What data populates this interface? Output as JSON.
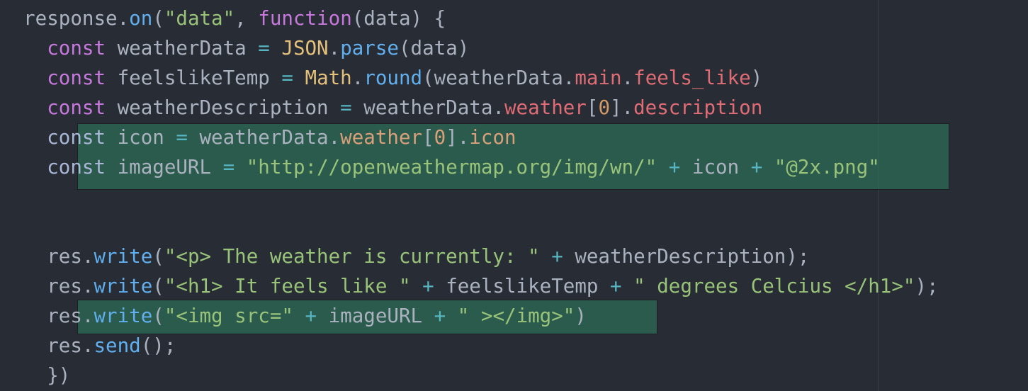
{
  "editor": {
    "lines": [
      {
        "indent": "  ",
        "tokens": [
          {
            "t": "response",
            "c": "id"
          },
          {
            "t": ".",
            "c": "id"
          },
          {
            "t": "on",
            "c": "f"
          },
          {
            "t": "(",
            "c": "id"
          },
          {
            "t": "\"data\"",
            "c": "s"
          },
          {
            "t": ", ",
            "c": "id"
          },
          {
            "t": "function",
            "c": "k"
          },
          {
            "t": "(data) {",
            "c": "id"
          }
        ]
      },
      {
        "indent": "    ",
        "tokens": [
          {
            "t": "const",
            "c": "k"
          },
          {
            "t": " weatherData ",
            "c": "id"
          },
          {
            "t": "=",
            "c": "o"
          },
          {
            "t": " ",
            "c": "id"
          },
          {
            "t": "JSON",
            "c": "c"
          },
          {
            "t": ".",
            "c": "id"
          },
          {
            "t": "parse",
            "c": "f"
          },
          {
            "t": "(data)",
            "c": "id"
          }
        ]
      },
      {
        "indent": "    ",
        "tokens": [
          {
            "t": "const",
            "c": "k"
          },
          {
            "t": " feelslikeTemp ",
            "c": "id"
          },
          {
            "t": "=",
            "c": "o"
          },
          {
            "t": " ",
            "c": "id"
          },
          {
            "t": "Math",
            "c": "c"
          },
          {
            "t": ".",
            "c": "id"
          },
          {
            "t": "round",
            "c": "f"
          },
          {
            "t": "(weatherData.",
            "c": "id"
          },
          {
            "t": "main",
            "c": "p"
          },
          {
            "t": ".",
            "c": "id"
          },
          {
            "t": "feels_like",
            "c": "p"
          },
          {
            "t": ")",
            "c": "id"
          }
        ]
      },
      {
        "indent": "    ",
        "tokens": [
          {
            "t": "const",
            "c": "k"
          },
          {
            "t": " weatherDescription ",
            "c": "id"
          },
          {
            "t": "=",
            "c": "o"
          },
          {
            "t": " weatherData.",
            "c": "id"
          },
          {
            "t": "weather",
            "c": "p"
          },
          {
            "t": "[",
            "c": "id"
          },
          {
            "t": "0",
            "c": "n"
          },
          {
            "t": "].",
            "c": "id"
          },
          {
            "t": "description",
            "c": "p"
          }
        ]
      },
      {
        "indent": "    ",
        "selected": true,
        "tokens": [
          {
            "t": "const",
            "c": "k"
          },
          {
            "t": " icon ",
            "c": "id"
          },
          {
            "t": "=",
            "c": "o"
          },
          {
            "t": " weatherData.",
            "c": "id"
          },
          {
            "t": "weather",
            "c": "p"
          },
          {
            "t": "[",
            "c": "id"
          },
          {
            "t": "0",
            "c": "n"
          },
          {
            "t": "].",
            "c": "id"
          },
          {
            "t": "icon",
            "c": "p"
          }
        ]
      },
      {
        "indent": "    ",
        "selected": true,
        "tokens": [
          {
            "t": "const",
            "c": "k"
          },
          {
            "t": " imageURL ",
            "c": "id"
          },
          {
            "t": "=",
            "c": "o"
          },
          {
            "t": " ",
            "c": "id"
          },
          {
            "t": "\"http://openweathermap.org/img/wn/\"",
            "c": "s"
          },
          {
            "t": " ",
            "c": "id"
          },
          {
            "t": "+",
            "c": "o"
          },
          {
            "t": " icon ",
            "c": "id"
          },
          {
            "t": "+",
            "c": "o"
          },
          {
            "t": " ",
            "c": "id"
          },
          {
            "t": "\"@2x.png\"",
            "c": "s"
          }
        ]
      },
      {
        "indent": "",
        "tokens": []
      },
      {
        "indent": "",
        "tokens": []
      },
      {
        "indent": "    ",
        "tokens": [
          {
            "t": "res.",
            "c": "id"
          },
          {
            "t": "write",
            "c": "f"
          },
          {
            "t": "(",
            "c": "id"
          },
          {
            "t": "\"<p> The weather is currently: \"",
            "c": "s"
          },
          {
            "t": " ",
            "c": "id"
          },
          {
            "t": "+",
            "c": "o"
          },
          {
            "t": " weatherDescription);",
            "c": "id"
          }
        ]
      },
      {
        "indent": "    ",
        "tokens": [
          {
            "t": "res.",
            "c": "id"
          },
          {
            "t": "write",
            "c": "f"
          },
          {
            "t": "(",
            "c": "id"
          },
          {
            "t": "\"<h1> It feels like \"",
            "c": "s"
          },
          {
            "t": " ",
            "c": "id"
          },
          {
            "t": "+",
            "c": "o"
          },
          {
            "t": " feelslikeTemp ",
            "c": "id"
          },
          {
            "t": "+",
            "c": "o"
          },
          {
            "t": " ",
            "c": "id"
          },
          {
            "t": "\" degrees Celcius </h1>\"",
            "c": "s"
          },
          {
            "t": ");",
            "c": "id"
          }
        ]
      },
      {
        "indent": "    ",
        "selected": true,
        "tokens": [
          {
            "t": "res.",
            "c": "id"
          },
          {
            "t": "write",
            "c": "f"
          },
          {
            "t": "(",
            "c": "id"
          },
          {
            "t": "\"<img src=\"",
            "c": "s"
          },
          {
            "t": " ",
            "c": "id"
          },
          {
            "t": "+",
            "c": "o"
          },
          {
            "t": " imageURL ",
            "c": "id"
          },
          {
            "t": "+",
            "c": "o"
          },
          {
            "t": " ",
            "c": "id"
          },
          {
            "t": "\" ></img>\"",
            "c": "s"
          },
          {
            "t": ")",
            "c": "id"
          }
        ]
      },
      {
        "indent": "    ",
        "tokens": [
          {
            "t": "res.",
            "c": "id"
          },
          {
            "t": "send",
            "c": "f"
          },
          {
            "t": "();",
            "c": "id"
          }
        ]
      },
      {
        "indent": "    ",
        "tokens": [
          {
            "t": "})",
            "c": "id"
          }
        ]
      }
    ]
  },
  "theme": {
    "background": "#282c34",
    "selection": "#2c6e58",
    "keyword": "#c678dd",
    "function": "#61afef",
    "string": "#98c379",
    "class": "#e5c07b",
    "property": "#e06c75",
    "number": "#d19a66",
    "operator": "#56b6c2",
    "text": "#abb2bf"
  }
}
